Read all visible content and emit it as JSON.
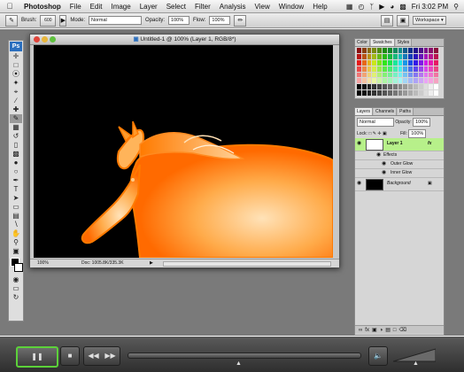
{
  "menubar": {
    "app": "Photoshop",
    "items": [
      "File",
      "Edit",
      "Image",
      "Layer",
      "Select",
      "Filter",
      "Analysis",
      "View",
      "Window",
      "Help"
    ],
    "clock": "Fri 3:02 PM"
  },
  "options": {
    "tool_label": "Brush:",
    "brush_size": "600",
    "mode_label": "Mode:",
    "mode_value": "Normal",
    "opacity_label": "Opacity:",
    "opacity_value": "100%",
    "flow_label": "Flow:",
    "flow_value": "100%",
    "workspace_label": "Workspace"
  },
  "document": {
    "title": "Untitled-1 @ 100% (Layer 1, RGB/8*)",
    "zoom": "100%",
    "doc_info": "Doc: 1005.8K/335.3K"
  },
  "color_panel": {
    "tabs": [
      "Color",
      "Swatches",
      "Styles"
    ],
    "active_tab": "Swatches"
  },
  "layers_panel": {
    "tabs": [
      "Layers",
      "Channels",
      "Paths"
    ],
    "blend_mode": "Normal",
    "opacity_label": "Opacity:",
    "opacity_value": "100%",
    "lock_label": "Lock:",
    "fill_label": "Fill:",
    "fill_value": "100%",
    "layers": [
      {
        "name": "Layer 1",
        "fx": "fx"
      },
      {
        "name": "Effects"
      },
      {
        "name": "Outer Glow"
      },
      {
        "name": "Inner Glow"
      },
      {
        "name": "Background"
      }
    ]
  },
  "colors": {
    "layer_selected": "#b7f08a",
    "glow_orange": "#ff7a00",
    "canvas": "#000000"
  },
  "controller": {
    "play_icon": "pause-icon",
    "volume_icon": "speaker-icon"
  }
}
